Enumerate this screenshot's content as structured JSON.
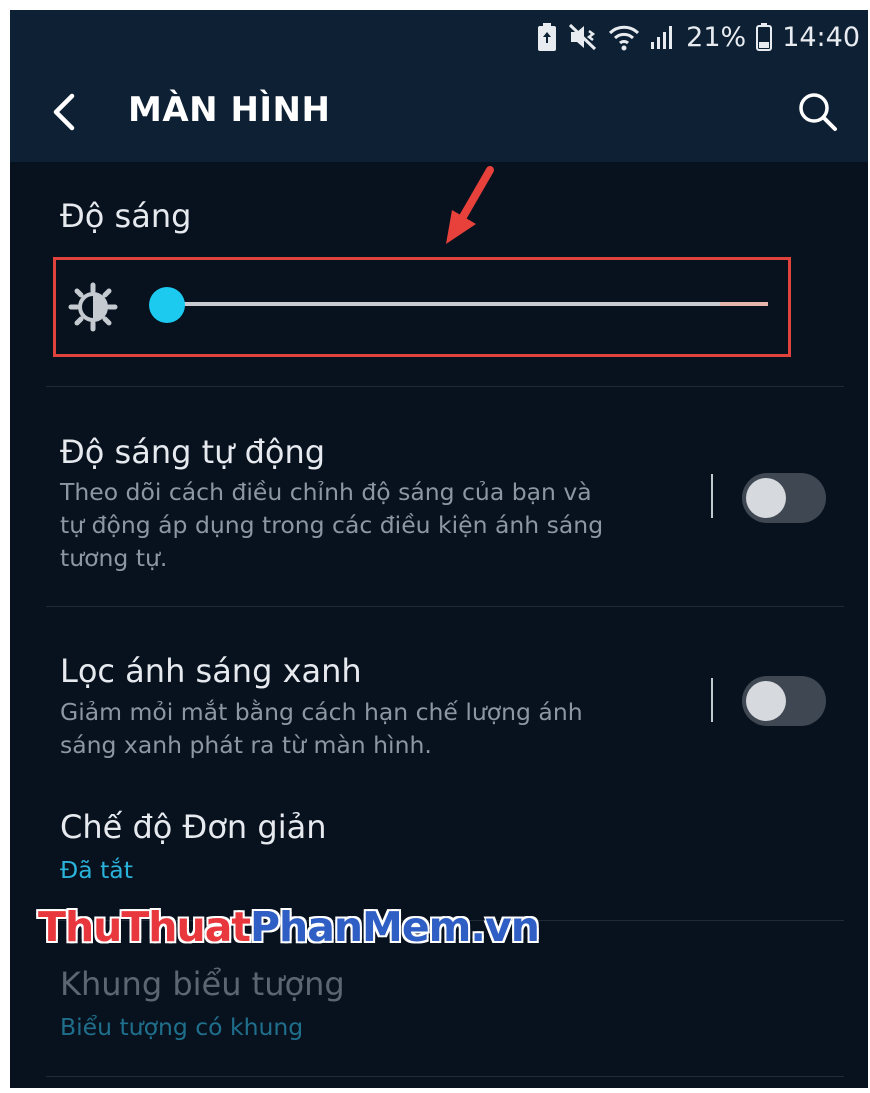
{
  "status_bar": {
    "battery_percent": "21%",
    "time": "14:40",
    "icons": [
      "battery-saver-icon",
      "mute-vibrate-icon",
      "wifi-icon",
      "signal-icon",
      "battery-icon"
    ]
  },
  "app_bar": {
    "title": "MÀN HÌNH",
    "back_icon": "chevron-left-icon",
    "search_icon": "search-icon"
  },
  "brightness": {
    "label": "Độ sáng",
    "level_fraction": 0.0,
    "icon": "brightness-icon"
  },
  "settings": [
    {
      "title": "Độ sáng tự động",
      "description": "Theo dõi cách điều chỉnh độ sáng của bạn và tự động áp dụng trong các điều kiện ánh sáng tương tự.",
      "toggle_on": false
    },
    {
      "title": "Lọc ánh sáng xanh",
      "description": "Giảm mỏi mắt bằng cách hạn chế lượng ánh sáng xanh phát ra từ màn hình.",
      "toggle_on": false
    },
    {
      "title": "Chế độ Đơn giản",
      "subtitle": "Đã tắt"
    },
    {
      "title": "Khung biểu tượng",
      "subtitle": "Biểu tượng có khung"
    }
  ],
  "watermark": {
    "part1": "ThuThuat",
    "part2": "PhanMem",
    "part3": ".vn"
  },
  "colors": {
    "accent": "#1ccaf0",
    "highlight_box": "#e0423c",
    "background": "#08121e",
    "app_bar": "#0d2034"
  }
}
